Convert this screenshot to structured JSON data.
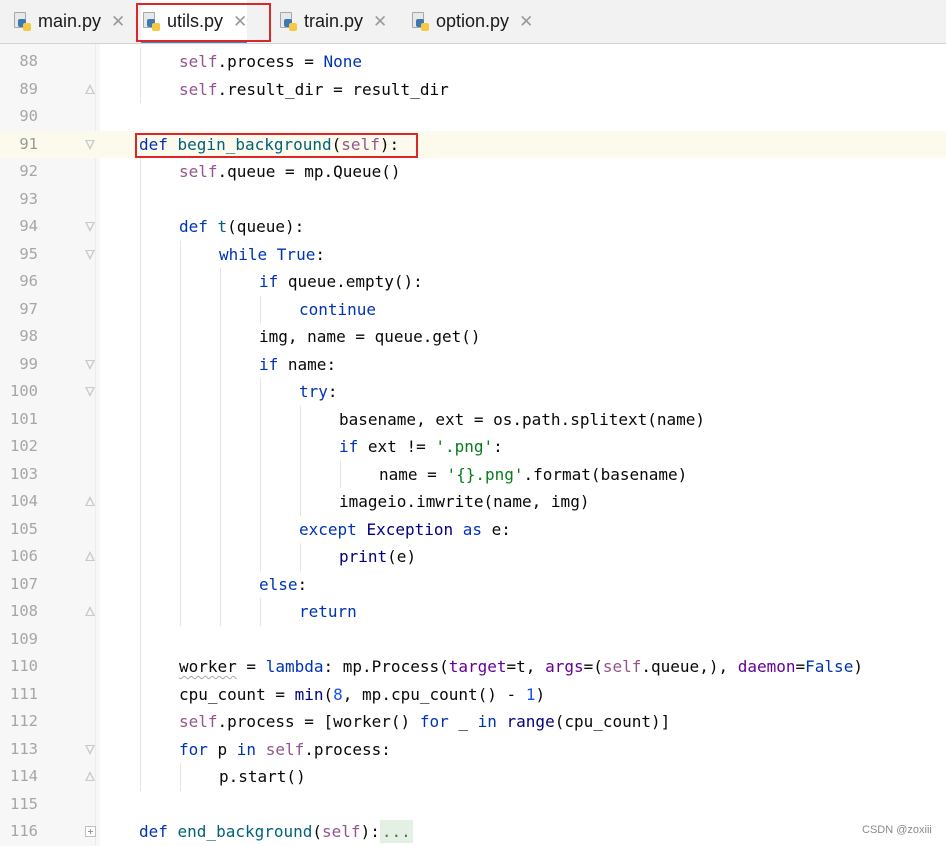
{
  "tabs": [
    {
      "label": "main.py",
      "active": false
    },
    {
      "label": "utils.py",
      "active": true
    },
    {
      "label": "train.py",
      "active": false
    },
    {
      "label": "option.py",
      "active": false
    }
  ],
  "close_glyph": "✕",
  "current_line": 91,
  "lines": [
    {
      "n": 88,
      "fold": "",
      "code": [
        [
          "s",
          "self"
        ],
        [
          "",
          ".process = "
        ],
        [
          "k",
          "None"
        ]
      ]
    },
    {
      "n": 89,
      "fold": "end",
      "code": [
        [
          "s",
          "self"
        ],
        [
          "",
          ".result_dir = result_dir"
        ]
      ]
    },
    {
      "n": 90,
      "fold": "",
      "code": []
    },
    {
      "n": 91,
      "fold": "start",
      "code": [
        [
          "k",
          "def "
        ],
        [
          "f",
          "begin_background"
        ],
        [
          "",
          "("
        ],
        [
          "s",
          "self"
        ],
        [
          "",
          "):"
        ]
      ]
    },
    {
      "n": 92,
      "fold": "",
      "code": [
        [
          "s",
          "self"
        ],
        [
          "",
          ".queue = mp.Queue()"
        ]
      ]
    },
    {
      "n": 93,
      "fold": "",
      "code": []
    },
    {
      "n": 94,
      "fold": "start",
      "code": [
        [
          "k",
          "def "
        ],
        [
          "f",
          "t"
        ],
        [
          "",
          "(queue):"
        ]
      ]
    },
    {
      "n": 95,
      "fold": "start",
      "code": [
        [
          "k",
          "while "
        ],
        [
          "k",
          "True"
        ],
        [
          "",
          ":"
        ]
      ]
    },
    {
      "n": 96,
      "fold": "",
      "code": [
        [
          "k",
          "if "
        ],
        [
          "",
          "queue.empty():"
        ]
      ]
    },
    {
      "n": 97,
      "fold": "",
      "code": [
        [
          "k",
          "continue"
        ]
      ]
    },
    {
      "n": 98,
      "fold": "",
      "code": [
        [
          "",
          "img, name = queue.get()"
        ]
      ]
    },
    {
      "n": 99,
      "fold": "start",
      "code": [
        [
          "k",
          "if "
        ],
        [
          "",
          "name:"
        ]
      ]
    },
    {
      "n": 100,
      "fold": "start",
      "code": [
        [
          "k",
          "try"
        ],
        [
          "",
          ":"
        ]
      ]
    },
    {
      "n": 101,
      "fold": "",
      "code": [
        [
          "",
          "basename, ext = os.path.splitext(name)"
        ]
      ]
    },
    {
      "n": 102,
      "fold": "",
      "code": [
        [
          "k",
          "if "
        ],
        [
          "",
          "ext != "
        ],
        [
          "str",
          "'.png'"
        ],
        [
          "",
          ":"
        ]
      ]
    },
    {
      "n": 103,
      "fold": "",
      "code": [
        [
          "",
          "name = "
        ],
        [
          "str",
          "'{}.png'"
        ],
        [
          "",
          ".format(basename)"
        ]
      ]
    },
    {
      "n": 104,
      "fold": "end",
      "code": [
        [
          "",
          "imageio.imwrite(name, img)"
        ]
      ]
    },
    {
      "n": 105,
      "fold": "",
      "code": [
        [
          "k",
          "except "
        ],
        [
          "bi",
          "Exception"
        ],
        [
          "k",
          " as "
        ],
        [
          "",
          "e:"
        ]
      ]
    },
    {
      "n": 106,
      "fold": "end",
      "code": [
        [
          "bi",
          "print"
        ],
        [
          "",
          "(e)"
        ]
      ]
    },
    {
      "n": 107,
      "fold": "",
      "code": [
        [
          "k",
          "else"
        ],
        [
          "",
          ":"
        ]
      ]
    },
    {
      "n": 108,
      "fold": "end",
      "code": [
        [
          "k",
          "return"
        ]
      ]
    },
    {
      "n": 109,
      "fold": "",
      "code": []
    },
    {
      "n": 110,
      "fold": "",
      "code": [
        [
          "sq",
          "worker"
        ],
        [
          "",
          " = "
        ],
        [
          "k",
          "lambda"
        ],
        [
          "",
          ": mp.Process("
        ],
        [
          "prm",
          "target"
        ],
        [
          "",
          "=t, "
        ],
        [
          "prm",
          "args"
        ],
        [
          "",
          "=("
        ],
        [
          "s",
          "self"
        ],
        [
          "",
          ".queue,), "
        ],
        [
          "prm",
          "daemon"
        ],
        [
          "",
          "="
        ],
        [
          "k",
          "False"
        ],
        [
          "",
          ")"
        ]
      ]
    },
    {
      "n": 111,
      "fold": "",
      "code": [
        [
          "",
          "cpu_count = "
        ],
        [
          "bi",
          "min"
        ],
        [
          "",
          "("
        ],
        [
          "n",
          "8"
        ],
        [
          "",
          ", mp.cpu_count() - "
        ],
        [
          "n",
          "1"
        ],
        [
          "",
          ")"
        ]
      ]
    },
    {
      "n": 112,
      "fold": "",
      "code": [
        [
          "s",
          "self"
        ],
        [
          "",
          ".process = [worker() "
        ],
        [
          "k",
          "for "
        ],
        [
          "",
          "_ "
        ],
        [
          "k",
          "in "
        ],
        [
          "bi",
          "range"
        ],
        [
          "",
          "(cpu_count)]"
        ]
      ]
    },
    {
      "n": 113,
      "fold": "start",
      "code": [
        [
          "k",
          "for "
        ],
        [
          "",
          "p "
        ],
        [
          "k",
          "in "
        ],
        [
          "s",
          "self"
        ],
        [
          "",
          ".process:"
        ]
      ]
    },
    {
      "n": 114,
      "fold": "end",
      "code": [
        [
          "",
          "p.start()"
        ]
      ]
    },
    {
      "n": 115,
      "fold": "",
      "code": []
    },
    {
      "n": 116,
      "fold": "collapsed",
      "code": [
        [
          "k",
          "def "
        ],
        [
          "f",
          "end_background"
        ],
        [
          "",
          "("
        ],
        [
          "s",
          "self"
        ],
        [
          "",
          "):"
        ],
        [
          "dots",
          "..."
        ]
      ]
    }
  ],
  "indent": [
    2,
    2,
    0,
    1,
    2,
    0,
    2,
    3,
    4,
    5,
    4,
    4,
    5,
    6,
    6,
    7,
    6,
    5,
    6,
    4,
    5,
    0,
    2,
    2,
    2,
    2,
    3,
    0,
    1
  ],
  "watermark": "CSDN @zoxiii"
}
